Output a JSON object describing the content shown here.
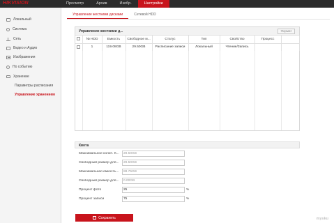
{
  "brand": {
    "logo": "HIKVISION"
  },
  "topnav": [
    "Просмотр",
    "Архив",
    "Изобр.",
    "Настройки"
  ],
  "topnav_active": 3,
  "sidebar": {
    "items": [
      {
        "label": "Локальный",
        "icon": "monitor-icon"
      },
      {
        "label": "Система",
        "icon": "system-icon"
      },
      {
        "label": "Сеть",
        "icon": "network-icon"
      },
      {
        "label": "Видео и Аудио",
        "icon": "video-icon"
      },
      {
        "label": "Изображения",
        "icon": "image-icon"
      },
      {
        "label": "По событию",
        "icon": "event-icon"
      },
      {
        "label": "Хранение",
        "icon": "storage-icon"
      },
      {
        "label": "Параметры расписания",
        "icon": ""
      },
      {
        "label": "Управление хранением",
        "icon": ""
      }
    ],
    "active_index": 8
  },
  "tabs": [
    "Управление жесткими дисками",
    "Сетевой HDD"
  ],
  "disk_panel": {
    "title": "Управление жесткими д...",
    "format_button": "Формат",
    "columns": [
      "№ HDD",
      "Емкость",
      "Свободное м...",
      "Статус",
      "Тип",
      "Свойство",
      "Процесс"
    ],
    "rows": [
      {
        "no": "1",
        "capacity": "119.08GB",
        "free": "29.50GB",
        "status": "Расписание записи",
        "type": "Локальный",
        "property": "Чтение/Запись",
        "progress": ""
      }
    ]
  },
  "quota": {
    "title": "Квота",
    "fields": [
      {
        "label": "Максимальное колич. К...",
        "value": "29.50GB",
        "unit": ""
      },
      {
        "label": "Свободный размер для...",
        "value": "29.50GB",
        "unit": ""
      },
      {
        "label": "Максимальная емкость...",
        "value": "88.75GB",
        "unit": ""
      },
      {
        "label": "Свободный размер для...",
        "value": "0.00GB",
        "unit": ""
      },
      {
        "label": "Процент фото",
        "value": "25",
        "unit": "%"
      },
      {
        "label": "Процент записи",
        "value": "75",
        "unit": "%"
      }
    ]
  },
  "save_button": "Сохранить",
  "watermark": "mysku"
}
